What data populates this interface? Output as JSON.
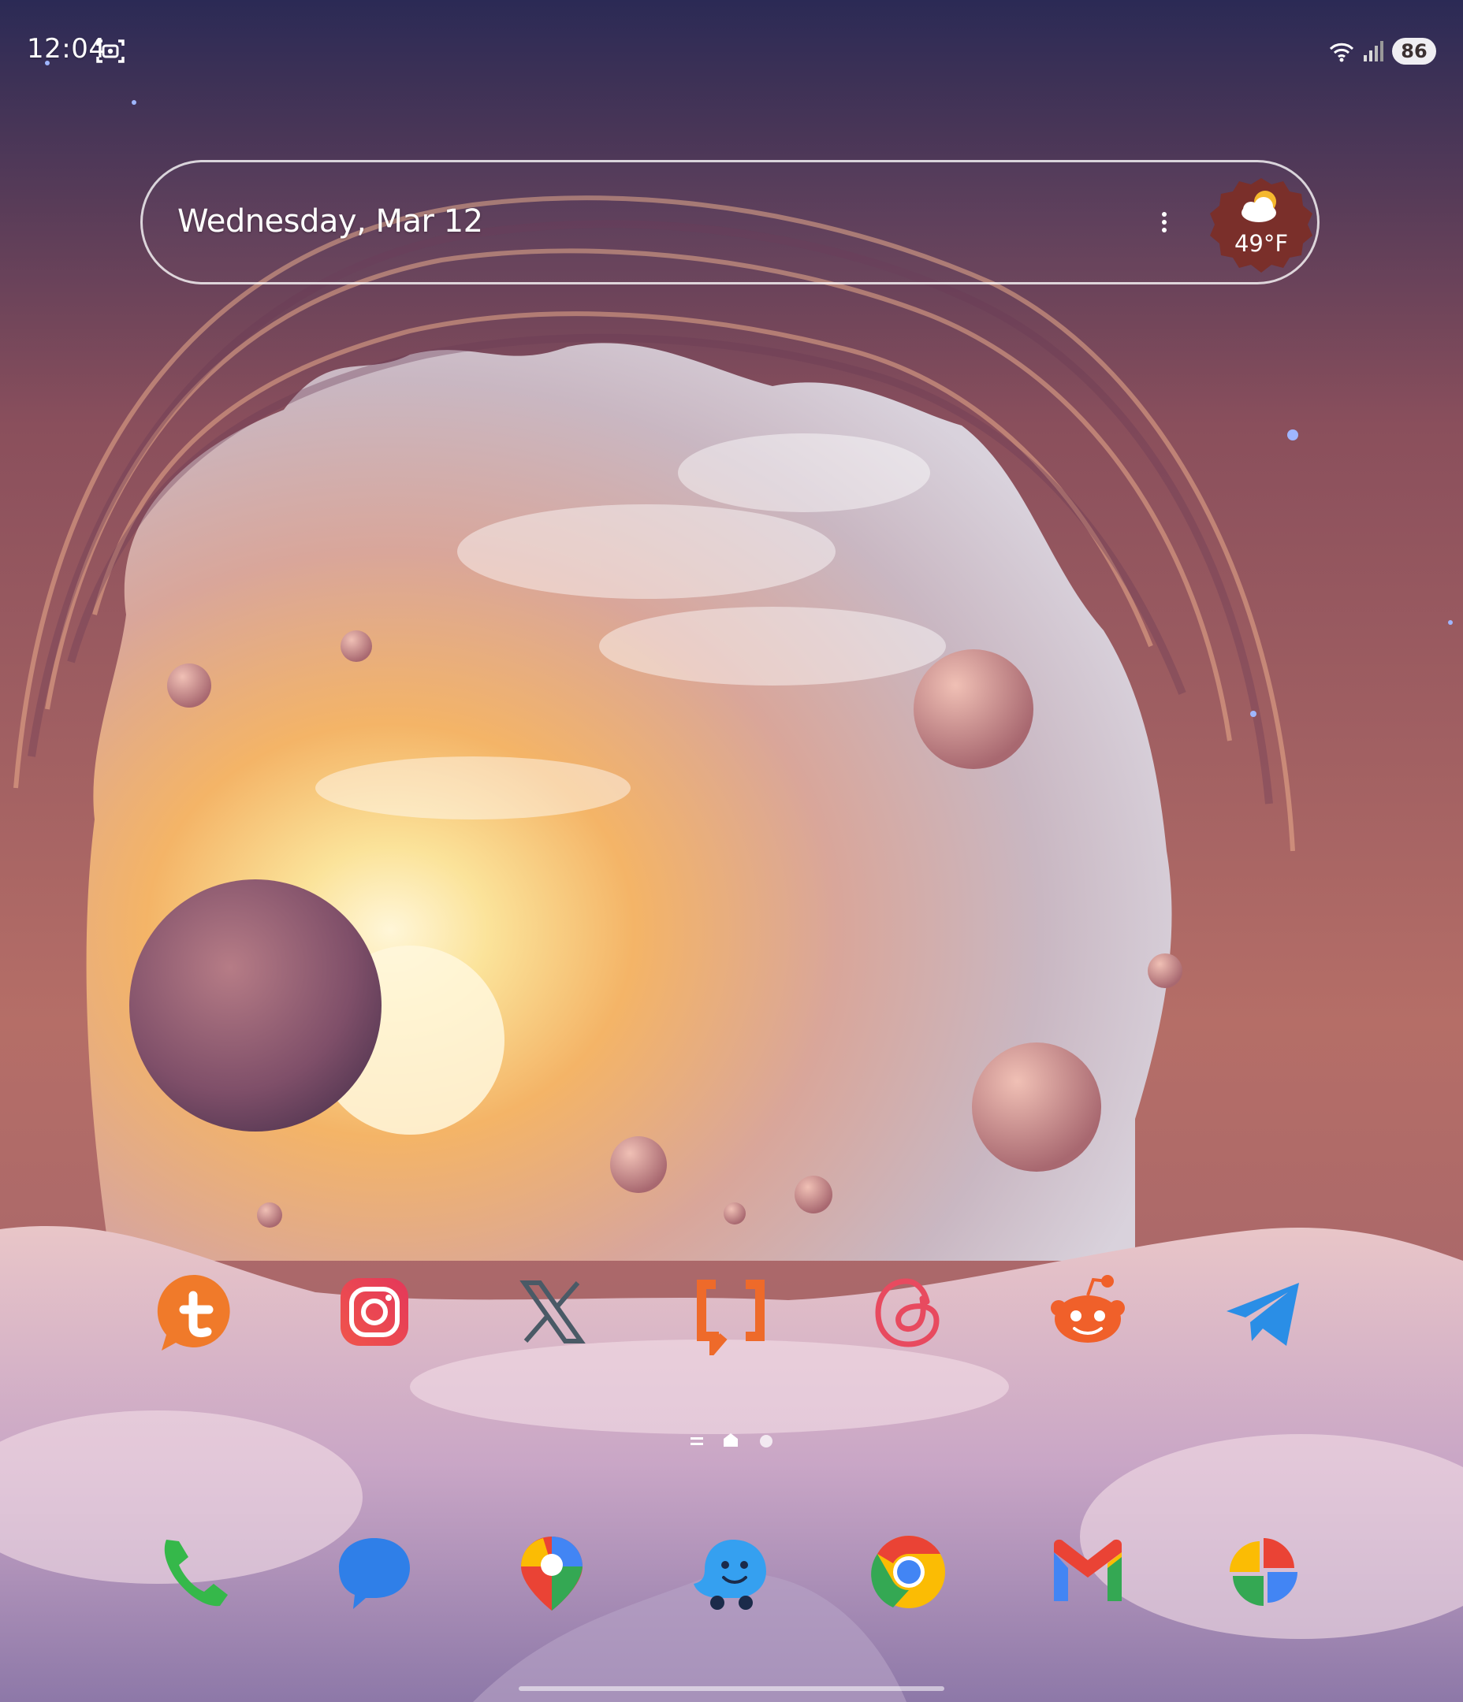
{
  "status_bar": {
    "time": "12:04",
    "battery_level": "86",
    "icons": [
      "screenshot-icon",
      "wifi-icon",
      "cell-signal-icon"
    ]
  },
  "glance_widget": {
    "date": "Wednesday, Mar 12",
    "weather_temp": "49°F",
    "weather_icon": "partly-cloudy-icon"
  },
  "home_row": {
    "apps": [
      {
        "name": "tumblr-like",
        "icon": "t-chat-icon"
      },
      {
        "name": "instagram",
        "icon": "instagram-icon"
      },
      {
        "name": "x",
        "icon": "x-icon"
      },
      {
        "name": "bracket-app",
        "icon": "bracket-icon"
      },
      {
        "name": "threads",
        "icon": "threads-icon"
      },
      {
        "name": "reddit",
        "icon": "reddit-icon"
      },
      {
        "name": "telegram",
        "icon": "telegram-icon"
      }
    ]
  },
  "page_indicator": {
    "pages": 3,
    "current": 2
  },
  "dock": {
    "apps": [
      {
        "name": "phone",
        "icon": "phone-icon"
      },
      {
        "name": "messages",
        "icon": "messages-icon"
      },
      {
        "name": "maps",
        "icon": "maps-icon"
      },
      {
        "name": "waze",
        "icon": "waze-icon"
      },
      {
        "name": "chrome",
        "icon": "chrome-icon"
      },
      {
        "name": "gmail",
        "icon": "gmail-icon"
      },
      {
        "name": "photos",
        "icon": "photos-icon"
      }
    ]
  },
  "colors": {
    "accent_weather_chip": "#7a2f2a",
    "wallpaper_sky": "#f7c46e",
    "wallpaper_rock": "#b56e67"
  }
}
